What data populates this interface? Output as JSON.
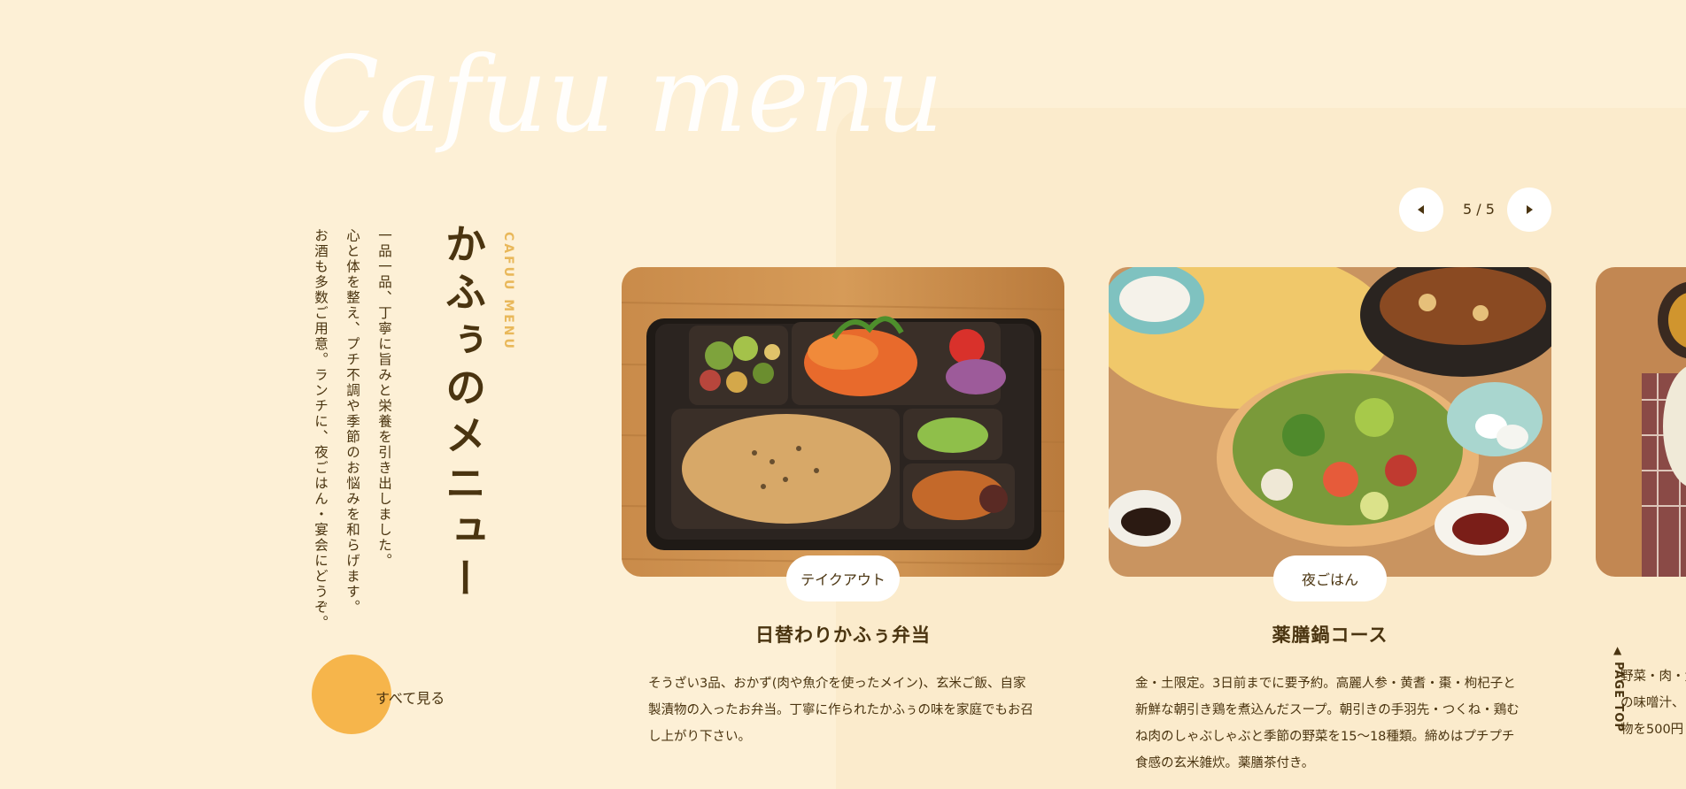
{
  "hero": {
    "script_title": "Cafuu menu"
  },
  "section": {
    "subtitle": "CAFUU MENU",
    "title": "かふぅのメニュー",
    "body_lines": [
      "一品一品、丁寧に旨みと栄養を引き出しました。",
      "心と体を整え、プチ不調や季節のお悩みを和らげます。",
      "お酒も多数ご用意。ランチに、夜ごはん・宴会にどうぞ。"
    ],
    "view_all_label": "すべて見る"
  },
  "pager": {
    "counter": "5 / 5",
    "prev_icon": "chevron-left-icon",
    "next_icon": "chevron-right-icon"
  },
  "cards": [
    {
      "tag": "テイクアウト",
      "name": "日替わりかふぅ弁当",
      "desc": "そうざい3品、おかず(肉や魚介を使ったメイン)、玄米ご飯、自家製漬物の入ったお弁当。丁寧に作られたかふぅの味を家庭でもお召し上がり下さい。"
    },
    {
      "tag": "夜ごはん",
      "name": "薬膳鍋コース",
      "desc": "金・土限定。3日前までに要予約。高麗人参・黄耆・棗・枸杞子と新鮮な朝引き鶏を煮込んだスープ。朝引きの手羽先・つくね・鶏むね肉のしゃぶしゃぶと季節の野菜を15〜18種類。締めはプチプチ食感の玄米雑炊。薬膳茶付き。"
    }
  ],
  "partial_card": {
    "desc_lines": [
      "野菜・肉・魚",
      "の味噌汁、",
      "物を500円"
    ]
  },
  "page_top": {
    "label": "PAGE TOP",
    "icon": "arrow-up-icon"
  },
  "colors": {
    "background": "#fdf0d6",
    "panel": "#fbebcc",
    "accent": "#f6b54b",
    "text": "#4a3410",
    "subtitle": "#e9b85a"
  }
}
